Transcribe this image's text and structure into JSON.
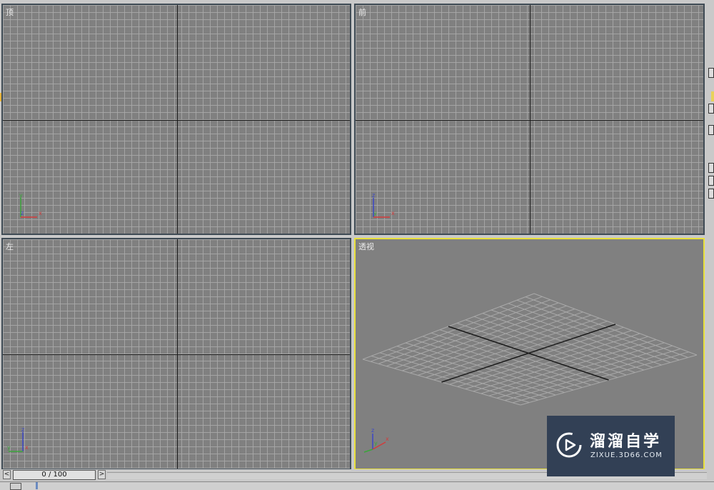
{
  "viewports": {
    "top": {
      "label": "顶",
      "gizmo": {
        "up": "y",
        "right": "x",
        "center": "z"
      }
    },
    "front": {
      "label": "前",
      "gizmo": {
        "up": "z",
        "right": "x",
        "center": "y"
      }
    },
    "left": {
      "label": "左",
      "gizmo": {
        "up": "z",
        "right": "x",
        "left": "y"
      }
    },
    "perspective": {
      "label": "透视",
      "active": true,
      "gizmo": {
        "up": "z",
        "right": "x",
        "center": "y"
      }
    }
  },
  "timebar": {
    "frame_display": "0 / 100",
    "prev_icon": "<",
    "next_icon": ">"
  },
  "watermark": {
    "title": "溜溜自学",
    "subtitle": "ZIXUE.3D66.COM"
  },
  "colors": {
    "viewport_bg": "#808080",
    "grid_line": "#aaaaaa",
    "axis_line": "#1a1a1a",
    "active_border": "#e8e03a",
    "x_axis": "#d23b3b",
    "y_axis": "#3aa53a",
    "z_axis": "#3a46c8",
    "watermark_bg": "#324055"
  }
}
